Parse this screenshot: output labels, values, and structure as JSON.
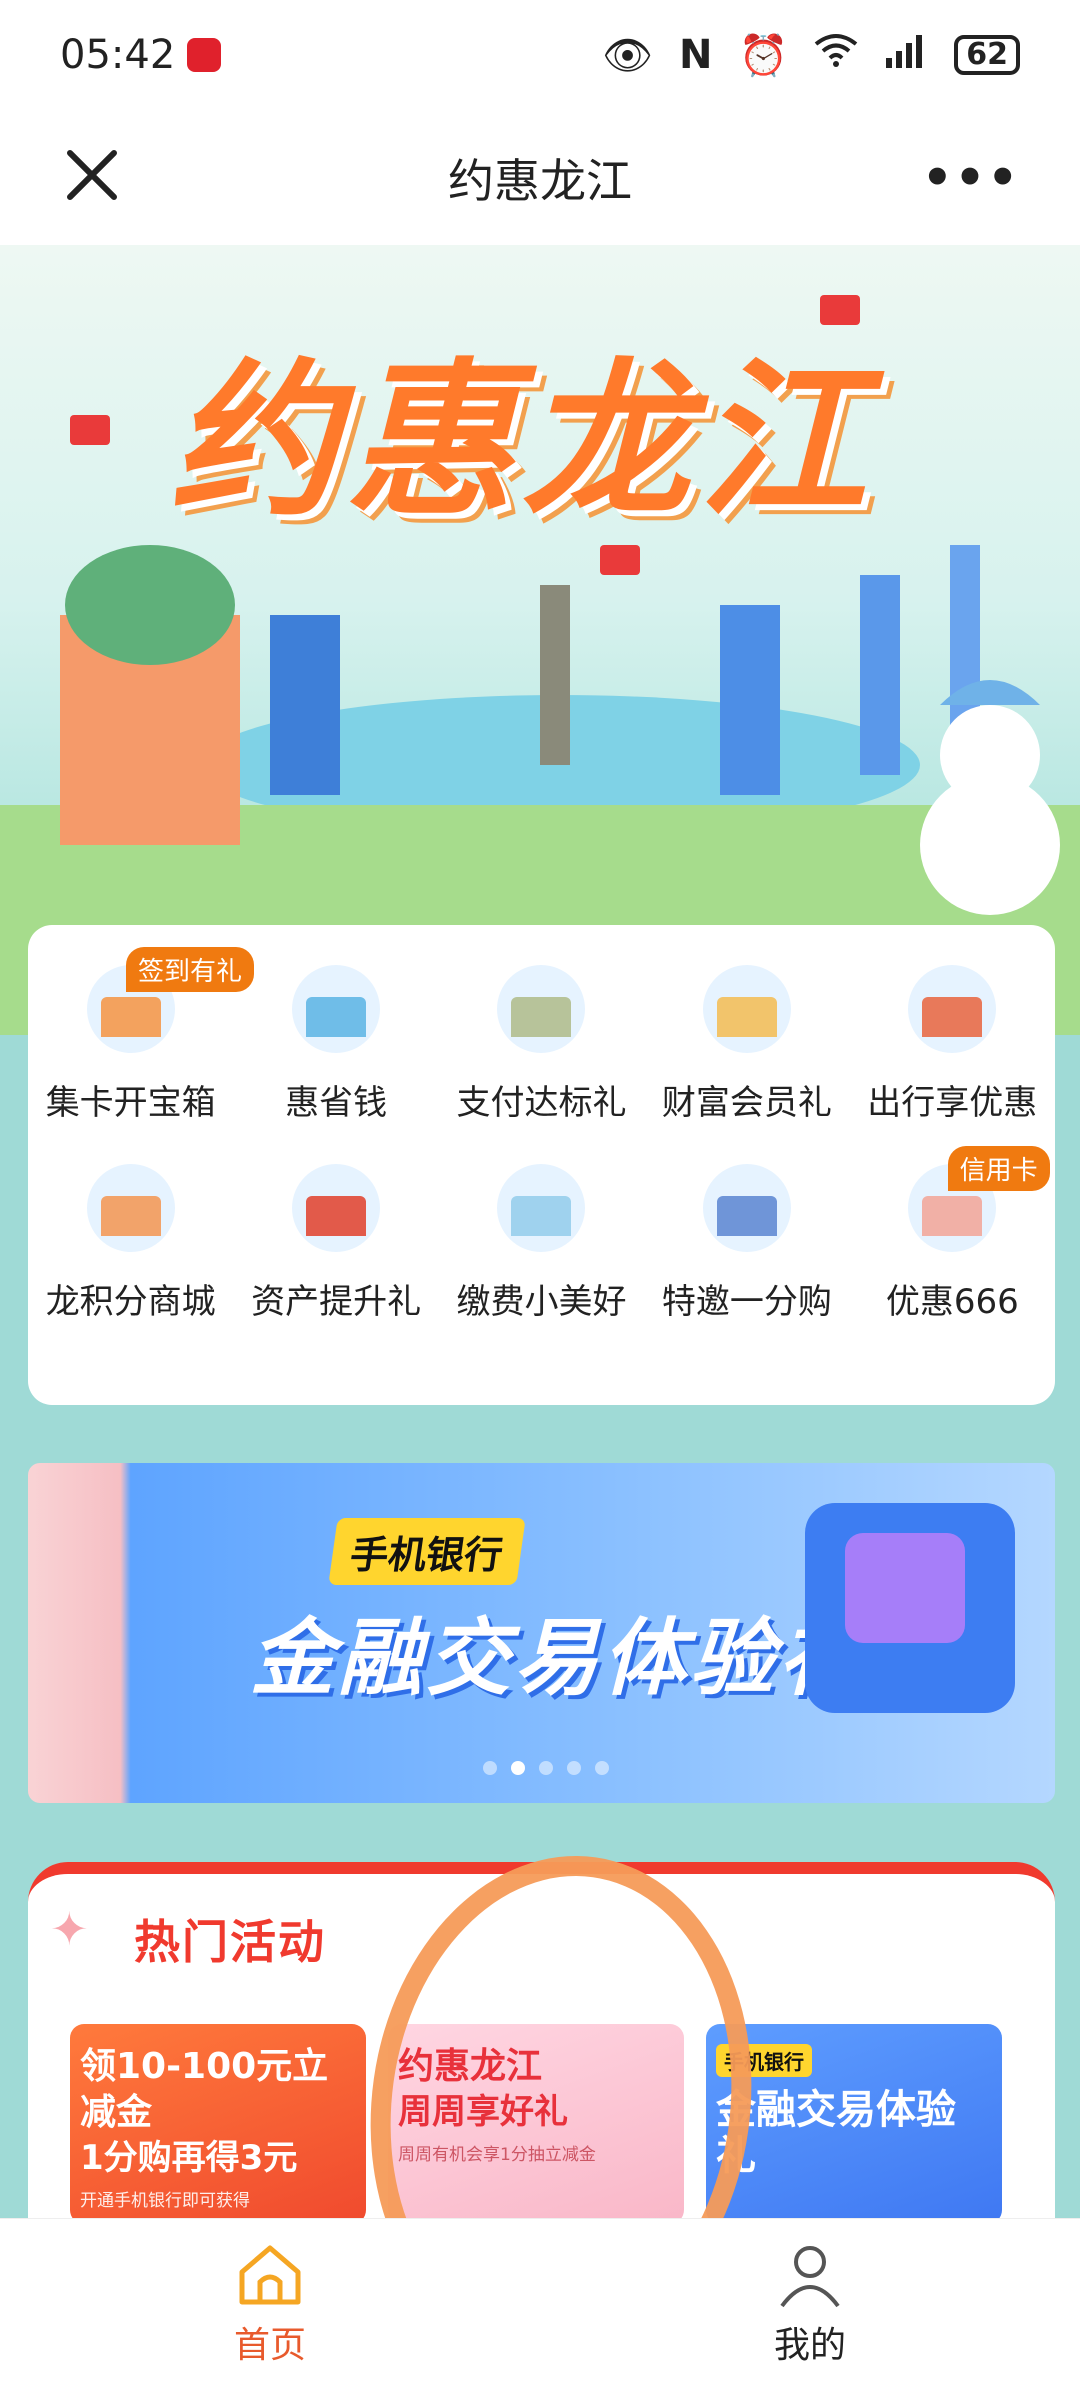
{
  "status_bar": {
    "time": "05:42",
    "battery": "62"
  },
  "nav": {
    "title": "约惠龙江"
  },
  "hero": {
    "title": "约惠龙江"
  },
  "grid": {
    "items": [
      {
        "label": "集卡开宝箱",
        "badge": "签到有礼",
        "color": "#f3a25e"
      },
      {
        "label": "惠省钱",
        "badge": "",
        "color": "#6fbde8"
      },
      {
        "label": "支付达标礼",
        "badge": "",
        "color": "#b7c39a"
      },
      {
        "label": "财富会员礼",
        "badge": "",
        "color": "#f2c46b"
      },
      {
        "label": "出行享优惠",
        "badge": "",
        "color": "#e8795a"
      },
      {
        "label": "龙积分商城",
        "badge": "",
        "color": "#f2a36a"
      },
      {
        "label": "资产提升礼",
        "badge": "",
        "color": "#e25a4a"
      },
      {
        "label": "缴费小美好",
        "badge": "",
        "color": "#9fd2ee"
      },
      {
        "label": "特邀一分购",
        "badge": "",
        "color": "#6f95d8"
      },
      {
        "label": "优惠666",
        "badge": "信用卡",
        "color": "#f1b0a6"
      }
    ]
  },
  "banner": {
    "tag": "手机银行",
    "title": "金融交易体验礼",
    "active_dot": 1,
    "dot_count": 5
  },
  "hot": {
    "title": "热门活动",
    "cards": [
      {
        "line1": "领10-100元立减金",
        "line2": "1分购再得3元",
        "line3": "开通手机银行即可获得"
      },
      {
        "line1": "约惠龙江",
        "line2": "周周享好礼",
        "line3": "周周有机会享1分抽立减金"
      },
      {
        "tag": "手机银行",
        "line1": "金融交易体验礼"
      }
    ]
  },
  "tabbar": {
    "tabs": [
      {
        "label": "首页",
        "active": true
      },
      {
        "label": "我的",
        "active": false
      }
    ]
  },
  "colors": {
    "accent": "#e85a2c",
    "background": "#9fdad6",
    "hot_red": "#f03a2e",
    "annotation": "#f59b59"
  }
}
